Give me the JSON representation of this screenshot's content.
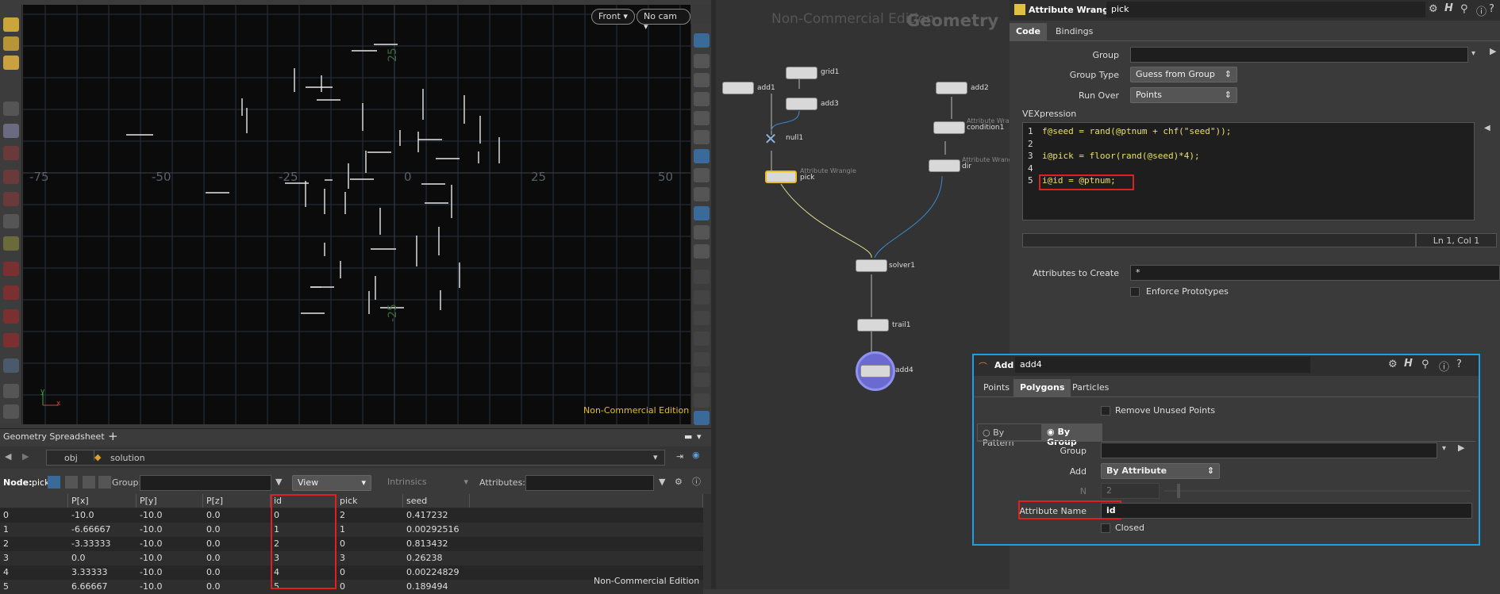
{
  "viewport": {
    "camera_button": "Front",
    "cam_button": "No cam",
    "watermark": "Non-Commercial Edition",
    "axis_x_labels": [
      "-75",
      "-50",
      "-25",
      "0",
      "25",
      "50"
    ],
    "axis_y_labels": [
      "25",
      "-25"
    ],
    "axis_origin": "x",
    "axis_y": "y"
  },
  "spreadsheet": {
    "title": "Geometry Spreadsheet",
    "path_obj": "obj",
    "path_node": "solution",
    "node_label": "Node:",
    "node_value": "pick",
    "group_label": "Group:",
    "view_button": "View",
    "intrinsics": "Intrinsics",
    "attributes_label": "Attributes:",
    "columns": [
      "",
      "P[x]",
      "P[y]",
      "P[z]",
      "id",
      "pick",
      "seed"
    ],
    "rows": [
      [
        "0",
        "-10.0",
        "-10.0",
        "0.0",
        "0",
        "2",
        "0.417232"
      ],
      [
        "1",
        "-6.66667",
        "-10.0",
        "0.0",
        "1",
        "1",
        "0.00292516"
      ],
      [
        "2",
        "-3.33333",
        "-10.0",
        "0.0",
        "2",
        "0",
        "0.813432"
      ],
      [
        "3",
        "0.0",
        "-10.0",
        "0.0",
        "3",
        "3",
        "0.26238"
      ],
      [
        "4",
        "3.33333",
        "-10.0",
        "0.0",
        "4",
        "0",
        "0.00224829"
      ],
      [
        "5",
        "6.66667",
        "-10.0",
        "0.0",
        "5",
        "0",
        "0.189494"
      ]
    ],
    "watermark": "Non-Commercial Edition"
  },
  "network": {
    "watermark": "Non-Commercial Edition",
    "context": "Geometry",
    "nodes": [
      {
        "name": "add1"
      },
      {
        "name": "grid1"
      },
      {
        "name": "add3"
      },
      {
        "name": "null1"
      },
      {
        "name": "pick",
        "type": "Attribute Wrangle"
      },
      {
        "name": "add2"
      },
      {
        "name": "condition1",
        "type": "Attribute Wrangle"
      },
      {
        "name": "dir",
        "type": "Attribute Wrangle"
      },
      {
        "name": "solver1"
      },
      {
        "name": "trail1"
      },
      {
        "name": "add4"
      }
    ]
  },
  "wrangle": {
    "type": "Attribute Wrangle",
    "name": "pick",
    "tabs": [
      "Code",
      "Bindings"
    ],
    "group_label": "Group",
    "group_type_label": "Group Type",
    "group_type_value": "Guess from Group",
    "run_over_label": "Run Over",
    "run_over_value": "Points",
    "vex_label": "VEXpression",
    "code_lines": [
      {
        "n": "1",
        "text": "f@seed = rand(@ptnum + chf(\"seed\"));"
      },
      {
        "n": "2",
        "text": ""
      },
      {
        "n": "3",
        "text": "i@pick = floor(rand(@seed)*4);"
      },
      {
        "n": "4",
        "text": ""
      },
      {
        "n": "5",
        "text": "i@id = @ptnum;"
      }
    ],
    "cursor_pos": "Ln 1, Col 1",
    "attrs_create_label": "Attributes to Create",
    "attrs_create_value": "*",
    "enforce_label": "Enforce Prototypes"
  },
  "add": {
    "type": "Add",
    "name": "add4",
    "tabs": [
      "Points",
      "Polygons",
      "Particles"
    ],
    "remove_unused": "Remove Unused Points",
    "by_pattern": "By Pattern",
    "by_group": "By Group",
    "group_label": "Group",
    "add_label": "Add",
    "add_value": "By Attribute",
    "n_label": "N",
    "n_value": "2",
    "attr_name_label": "Attribute Name",
    "attr_name_value": "id",
    "closed_label": "Closed"
  }
}
